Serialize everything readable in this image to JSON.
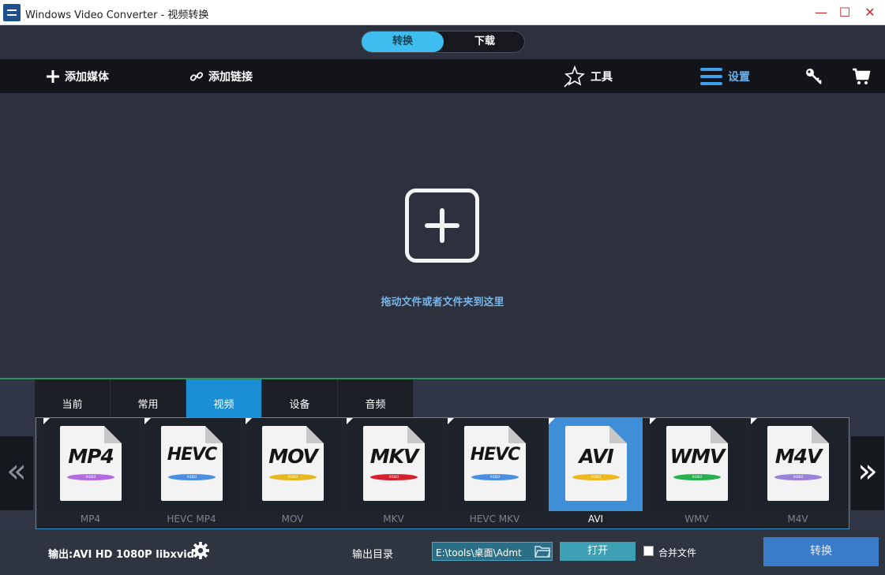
{
  "window": {
    "title": "Windows Video Converter - 视频转换",
    "minimize_glyph": "—",
    "maximize_glyph": "☐",
    "close_glyph": "✕"
  },
  "mode_switch": {
    "convert_label": "转换",
    "download_label": "下载",
    "active": "convert"
  },
  "toolbar": {
    "add_media_label": "添加媒体",
    "add_link_label": "添加链接",
    "tools_label": "工具",
    "settings_label": "设置"
  },
  "drop_zone": {
    "hint": "拖动文件或者文件夹到这里"
  },
  "format_tabs": [
    {
      "label": "当前",
      "active": false
    },
    {
      "label": "常用",
      "active": false
    },
    {
      "label": "视频",
      "active": true
    },
    {
      "label": "设备",
      "active": false
    },
    {
      "label": "音频",
      "active": false
    }
  ],
  "formats": [
    {
      "icon_text": "MP4",
      "label": "MP4",
      "pill_color": "#b26ae0",
      "selected": false
    },
    {
      "icon_text": "HEVC",
      "label": "HEVC MP4",
      "pill_color": "#4b8fe0",
      "selected": false
    },
    {
      "icon_text": "MOV",
      "label": "MOV",
      "pill_color": "#e6b81f",
      "selected": false
    },
    {
      "icon_text": "MKV",
      "label": "MKV",
      "pill_color": "#d8202c",
      "selected": false
    },
    {
      "icon_text": "HEVC",
      "label": "HEVC MKV",
      "pill_color": "#4b8fe0",
      "selected": false
    },
    {
      "icon_text": "AVI",
      "label": "AVI",
      "pill_color": "#f0b81e",
      "selected": true
    },
    {
      "icon_text": "WMV",
      "label": "WMV",
      "pill_color": "#27b04d",
      "selected": false
    },
    {
      "icon_text": "M4V",
      "label": "M4V",
      "pill_color": "#9a82d8",
      "selected": false
    }
  ],
  "format_icon_badge": "VIDEO",
  "nav": {
    "prev_glyph": "«",
    "next_glyph": "»"
  },
  "bottom": {
    "output_format": "输出:AVI HD 1080P libxvid",
    "output_dir_label": "输出目录",
    "output_dir_value": "E:\\tools\\桌面\\Admt",
    "open_label": "打开",
    "merge_label": "合并文件",
    "merge_checked": false,
    "convert_label": "转换"
  },
  "colors": {
    "accent": "#3fbdee",
    "tab_active": "#1a8fd6",
    "selected_cell": "#3e8ed8",
    "divider": "#2b8f56",
    "hint": "#78b3e6"
  }
}
